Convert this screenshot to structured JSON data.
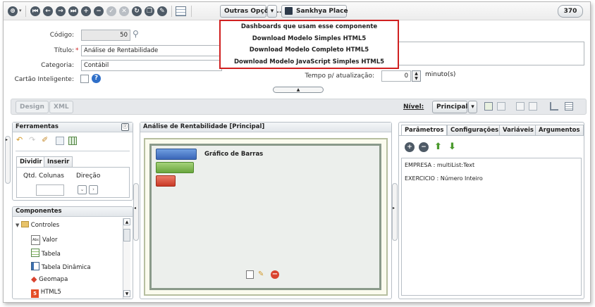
{
  "toolbar": {
    "outras_label": "Outras Opções...",
    "sankhya_label": "Sankhya Place",
    "counter": "370"
  },
  "menu": {
    "items": [
      "Dashboards que usam esse componente",
      "Download Modelo Simples HTML5",
      "Download Modelo Completo HTML5",
      "Download Modelo JavaScript Simples HTML5"
    ]
  },
  "form": {
    "codigo_label": "Código:",
    "codigo_value": "50",
    "titulo_label": "Título:",
    "titulo_value": "Análise de Rentabilidade",
    "categoria_label": "Categoria:",
    "categoria_value": "Contábil",
    "cartao_label": "Cartão Inteligente:",
    "required_mark": "*",
    "tempo_label": "Tempo p/ atualização:",
    "tempo_value": "0",
    "minutos_label": "minuto(s)"
  },
  "bar": {
    "design_label": "Design",
    "xml_label": "XML",
    "nivel_label": "Nível:",
    "nivel_value": "Principal"
  },
  "ferramentas": {
    "title": "Ferramentas",
    "tab_dividir": "Dividir",
    "tab_inserir": "Inserir",
    "col_qtd": "Qtd. Colunas",
    "col_direcao": "Direção"
  },
  "componentes": {
    "title": "Componentes",
    "root": "Controles",
    "items": [
      "Valor",
      "Tabela",
      "Tabela Dinâmica",
      "Geomapa",
      "HTML5"
    ]
  },
  "center": {
    "title": "Análise de Rentabilidade [Principal]",
    "chart_label": "Gráfico de Barras"
  },
  "right": {
    "tabs": [
      "Parâmetros",
      "Configurações",
      "Variáveis",
      "Argumentos"
    ],
    "params": [
      "EMPRESA : multiList:Text",
      "EXERCICIO : Número Inteiro"
    ]
  },
  "colors": {
    "accent_red": "#d02020",
    "bar_blue": "#4a78c8",
    "bar_green": "#7ab648",
    "bar_red": "#d9432f"
  }
}
